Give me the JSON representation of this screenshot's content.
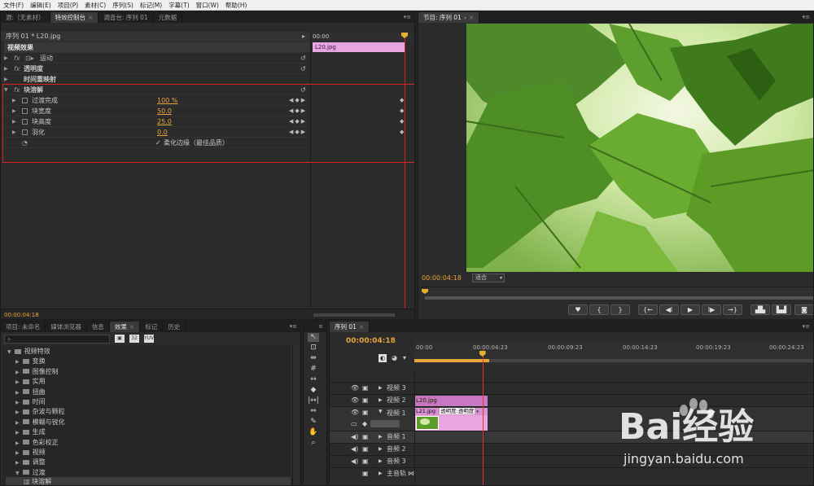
{
  "menu": [
    "文件(F)",
    "编辑(E)",
    "项目(P)",
    "素材(C)",
    "序列(S)",
    "标记(M)",
    "字幕(T)",
    "窗口(W)",
    "帮助(H)"
  ],
  "top_tabs": [
    "源:（无素材）",
    "特效控制台",
    "调音台: 序列 01",
    "元数据"
  ],
  "effect_controls": {
    "clip_path": "序列 01 * L20.jpg",
    "time_start": "00:00",
    "clip_name": "L20.jpg",
    "section_title": "视频效果",
    "effects": [
      "运动",
      "透明度",
      "时间重映射",
      "块溶解"
    ],
    "params": [
      {
        "label": "过渡完成",
        "value": "100 %"
      },
      {
        "label": "块宽度",
        "value": "50.0"
      },
      {
        "label": "块高度",
        "value": "25.0"
      },
      {
        "label": "羽化",
        "value": "0.0"
      }
    ],
    "soft_edge_label": "柔化边缘（最佳品质）",
    "current_time": "00:00:04:18"
  },
  "program": {
    "tab": "节目: 序列 01",
    "timecode": "00:00:04:18",
    "fit": "适合"
  },
  "effects_panel": {
    "tabs": [
      "项目: 未命名",
      "媒体浏览器",
      "信息",
      "效果",
      "标记",
      "历史"
    ],
    "root": "视频特效",
    "folders": [
      "变换",
      "图像控制",
      "实用",
      "扭曲",
      "时间",
      "杂波与颗粒",
      "模糊与锐化",
      "生成",
      "色彩校正",
      "视频",
      "调整",
      "过渡"
    ],
    "child": "块溶解"
  },
  "timeline": {
    "tab": "序列 01",
    "timecode": "00:00:04:18",
    "ruler": [
      "00:00",
      "00:00:04:23",
      "00:00:09:23",
      "00:00:14:23",
      "00:00:19:23",
      "00:00:24:23"
    ],
    "tracks": [
      "视频 3",
      "视频 2",
      "视频 1",
      "音频 1",
      "音频 2",
      "音频 3",
      "主音轨"
    ],
    "clip_top": "L20.jpg",
    "clip_bottom": "L21.jpg",
    "clip_bottom_fx": "透明度:透明度",
    "playhead_fraction": 0.17
  },
  "watermark": {
    "text": "Bai经验",
    "url": "jingyan.baidu.com"
  }
}
